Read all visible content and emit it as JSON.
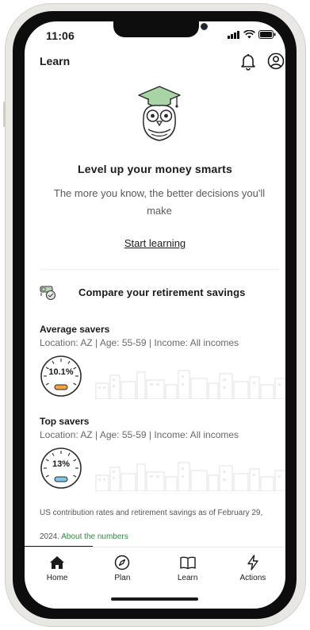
{
  "status_bar": {
    "time": "11:06"
  },
  "header": {
    "title": "Learn"
  },
  "hero": {
    "heading": "Level up your money smarts",
    "subtext": "The more you know, the better decisions you'll make",
    "link_label": "Start learning"
  },
  "compare": {
    "heading": "Compare your retirement savings",
    "groups": [
      {
        "title": "Average savers",
        "meta": "Location: AZ | Age: 55-59 | Income: All incomes",
        "rate": "10.1%",
        "accent": "#f4a340"
      },
      {
        "title": "Top savers",
        "meta": "Location: AZ | Age: 55-59 | Income: All incomes",
        "rate": "13%",
        "accent": "#7cc8e8"
      }
    ],
    "footnote_line1": "US contribution rates and retirement savings as of February 29,",
    "footnote_line2": "2024.",
    "about_link": "About the numbers"
  },
  "tabs": [
    {
      "label": "Home"
    },
    {
      "label": "Plan"
    },
    {
      "label": "Learn"
    },
    {
      "label": "Actions"
    }
  ],
  "colors": {
    "link_green": "#2e8b3c",
    "owl_cap": "#a9d5a6"
  }
}
